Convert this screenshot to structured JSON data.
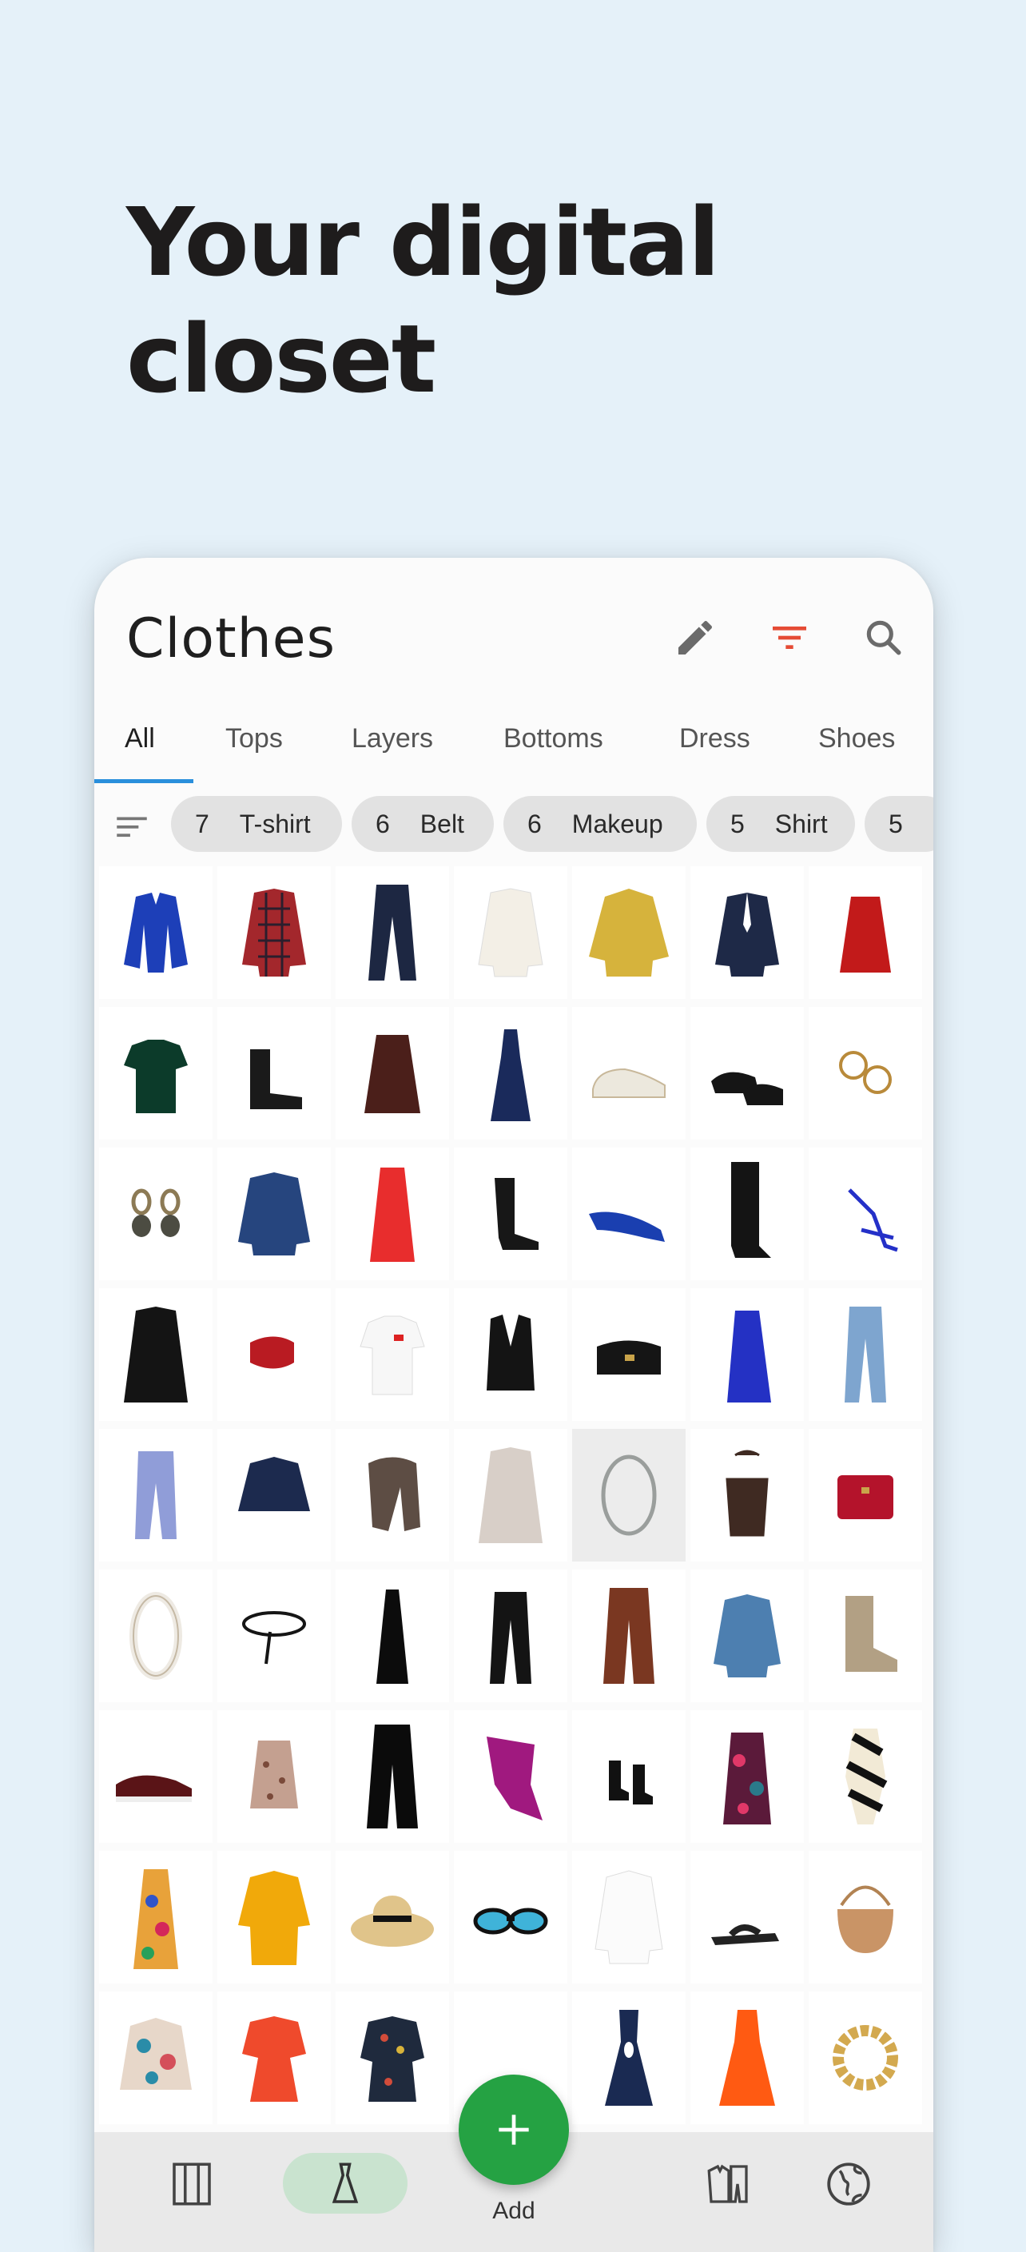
{
  "headline": {
    "line1": "Your digital",
    "line2": "closet"
  },
  "screen": {
    "title": "Clothes",
    "icons": {
      "edit": "pencil-icon",
      "filter": "filter-icon",
      "search": "search-icon"
    },
    "colors": {
      "filter_icon": "#e54b35",
      "tab_indicator": "#2a8fdc",
      "fab": "#25a243",
      "nav_pill": "#c9e3cf"
    },
    "tabs": [
      "All",
      "Tops",
      "Layers",
      "Bottoms",
      "Dress",
      "Shoes"
    ],
    "active_tab": "All",
    "chips": [
      {
        "count": "7",
        "label": "T-shirt"
      },
      {
        "count": "6",
        "label": "Belt"
      },
      {
        "count": "6",
        "label": "Makeup"
      },
      {
        "count": "5",
        "label": "Shirt"
      },
      {
        "count": "5",
        "label": ""
      }
    ],
    "items": [
      [
        "blue-cardigan",
        "plaid-shirt",
        "navy-trousers",
        "white-blouse",
        "yellow-shirt",
        "navy-blazer",
        "red-skirt"
      ],
      [
        "green-tshirt",
        "black-ankle-boots",
        "brown-skirt",
        "navy-slip-dress",
        "white-sneakers",
        "black-loafers",
        "gold-hoop-earrings"
      ],
      [
        "chain-earrings",
        "denim-shirt",
        "red-midi-skirt",
        "black-heeled-boots",
        "blue-pumps",
        "black-knee-boots",
        "blue-strappy-sandals"
      ],
      [
        "black-coat",
        "red-belt",
        "white-tshirt",
        "black-vest",
        "black-bag",
        "blue-wrap-dress",
        "light-jeans"
      ],
      [
        "lavender-joggers",
        "navy-jacket",
        "brown-scarf",
        "beige-coat",
        "silver-necklace",
        "brown-bucket-bag",
        "red-bag"
      ],
      [
        "pearl-necklace",
        "black-thin-belt",
        "black-slip-dress",
        "black-trousers",
        "brown-wide-trousers",
        "denim-shirt-2",
        "tan-cowboy-boots"
      ],
      [
        "burgundy-loafers",
        "floral-top",
        "black-wide-pants",
        "magenta-top",
        "black-chelsea-boots",
        "floral-dress",
        "striped-swimsuit"
      ],
      [
        "print-maxi-dress",
        "mustard-shirt-dress",
        "straw-hat",
        "sunglasses",
        "white-shirt",
        "black-sandals",
        "wicker-bag"
      ],
      [
        "print-blouse",
        "coral-dress",
        "embroidered-dress",
        "empty",
        "navy-cutout-dress",
        "orange-dress",
        "gold-chain-bracelet"
      ]
    ],
    "nav": {
      "items": [
        "wardrobe-icon",
        "dress-icon",
        "outfits-icon",
        "globe-icon"
      ],
      "add_label": "Add"
    }
  }
}
